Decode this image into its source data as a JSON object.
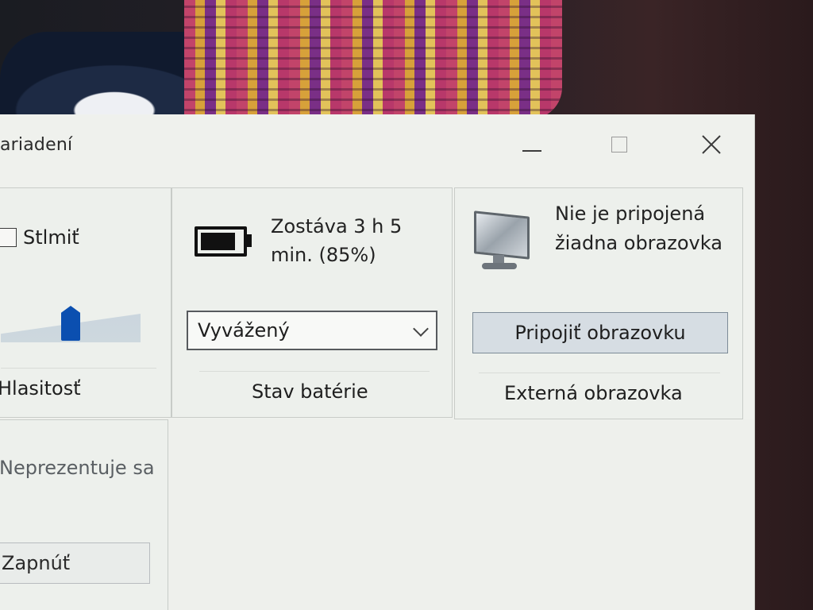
{
  "window": {
    "title": "ariadení",
    "controls": {
      "minimize_icon": "minimize-icon",
      "maximize_icon": "maximize-icon",
      "close_icon": "close-icon"
    }
  },
  "volume": {
    "mute_label": "Stlmiť",
    "mute_checked": false,
    "slider_level_percent": 50,
    "footer": "Hlasitosť"
  },
  "battery": {
    "status_text": "Zostáva 3 h 5 min. (85%)",
    "charge_percent": 85,
    "power_plan": "Vyvážený",
    "footer": "Stav batérie"
  },
  "display": {
    "status_text": "Nie je pripojená žiadna obrazovka",
    "connect_button": "Pripojiť obrazovku",
    "footer": "Externá obrazovka"
  },
  "presentation": {
    "status_text": "Neprezentuje sa",
    "toggle_button": "Zapnúť"
  },
  "colors": {
    "window_bg": "#eff1ed",
    "accent_slider": "#0b4fb0",
    "button_bg": "#d6dde3"
  }
}
